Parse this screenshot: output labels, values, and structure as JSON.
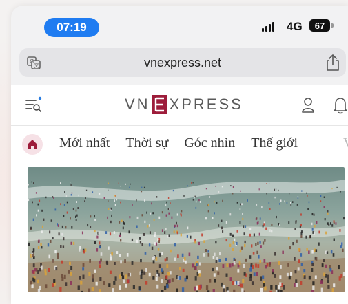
{
  "status_bar": {
    "time": "07:19",
    "network": "4G",
    "battery": "67"
  },
  "browser": {
    "url": "vnexpress.net"
  },
  "site": {
    "logo_left": "VN",
    "logo_mark": "E",
    "logo_right": "XPRESS",
    "brand_color": "#9d1c3a"
  },
  "nav": {
    "items": [
      "Mới nhất",
      "Thời sự",
      "Góc nhìn",
      "Thế giới"
    ],
    "overflow": "V"
  },
  "colors": {
    "time_pill": "#1f7cf1",
    "home_accent": "#9d1c3a"
  },
  "icons": [
    "translate-icon",
    "share-icon",
    "menu-search-icon",
    "user-icon",
    "bell-icon",
    "home-icon"
  ]
}
